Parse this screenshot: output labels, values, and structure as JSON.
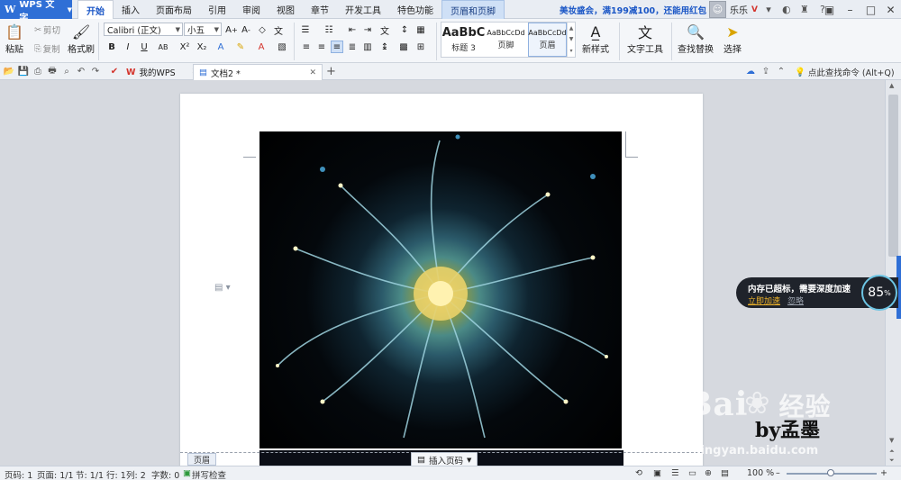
{
  "app": {
    "menu_button": "WPS 文字",
    "logo_glyph": "W",
    "promo": "美妆盛会，满199减100，还能用红包"
  },
  "tabs": [
    "开始",
    "插入",
    "页面布局",
    "引用",
    "审阅",
    "视图",
    "章节",
    "开发工具",
    "特色功能",
    "页眉和页脚"
  ],
  "active_tab": "开始",
  "user": {
    "name": "乐乐",
    "badge": "V"
  },
  "ribbon": {
    "paste": "粘贴",
    "cut": "剪切",
    "copy": "复制",
    "format_painter": "格式刷",
    "font_name": "Calibri (正文)",
    "font_size": "小五",
    "new_style": "新样式",
    "text_tools": "文字工具",
    "find_replace": "查找替换",
    "select": "选择",
    "styles": [
      {
        "sample": "AaBbC",
        "name": "标题 3"
      },
      {
        "sample": "AaBbCcDd",
        "name": "页脚"
      },
      {
        "sample": "AaBbCcDd",
        "name": "页眉"
      }
    ]
  },
  "doc_tabs": {
    "home": "我的WPS",
    "document": "文档2 *"
  },
  "search_command": "点此查找命令 (Alt+Q)",
  "document": {
    "header_label": "页眉",
    "insert_page_number": "插入页码"
  },
  "memory_toast": {
    "message": "内存已超标，需要深度加速",
    "boost": "立即加速",
    "ignore": "忽略",
    "gauge_value": "85",
    "gauge_unit": "%"
  },
  "watermark": {
    "baidu": "Bai",
    "jingyan": "经验",
    "url": "jingyan.baidu.com",
    "signature": "by孟墨"
  },
  "status": {
    "page_num": "页码: 1",
    "pages": "页面: 1/1",
    "section": "节: 1/1",
    "row": "行: 1",
    "col": "列: 2",
    "words": "字数: 0",
    "spellcheck": "拼写检查",
    "zoom": "100 %"
  },
  "colors": {
    "accent": "#2f6fd6",
    "context_tab": "#cfe0f6",
    "toast_bg": "#1f232b",
    "boost_link": "#f0b429"
  }
}
